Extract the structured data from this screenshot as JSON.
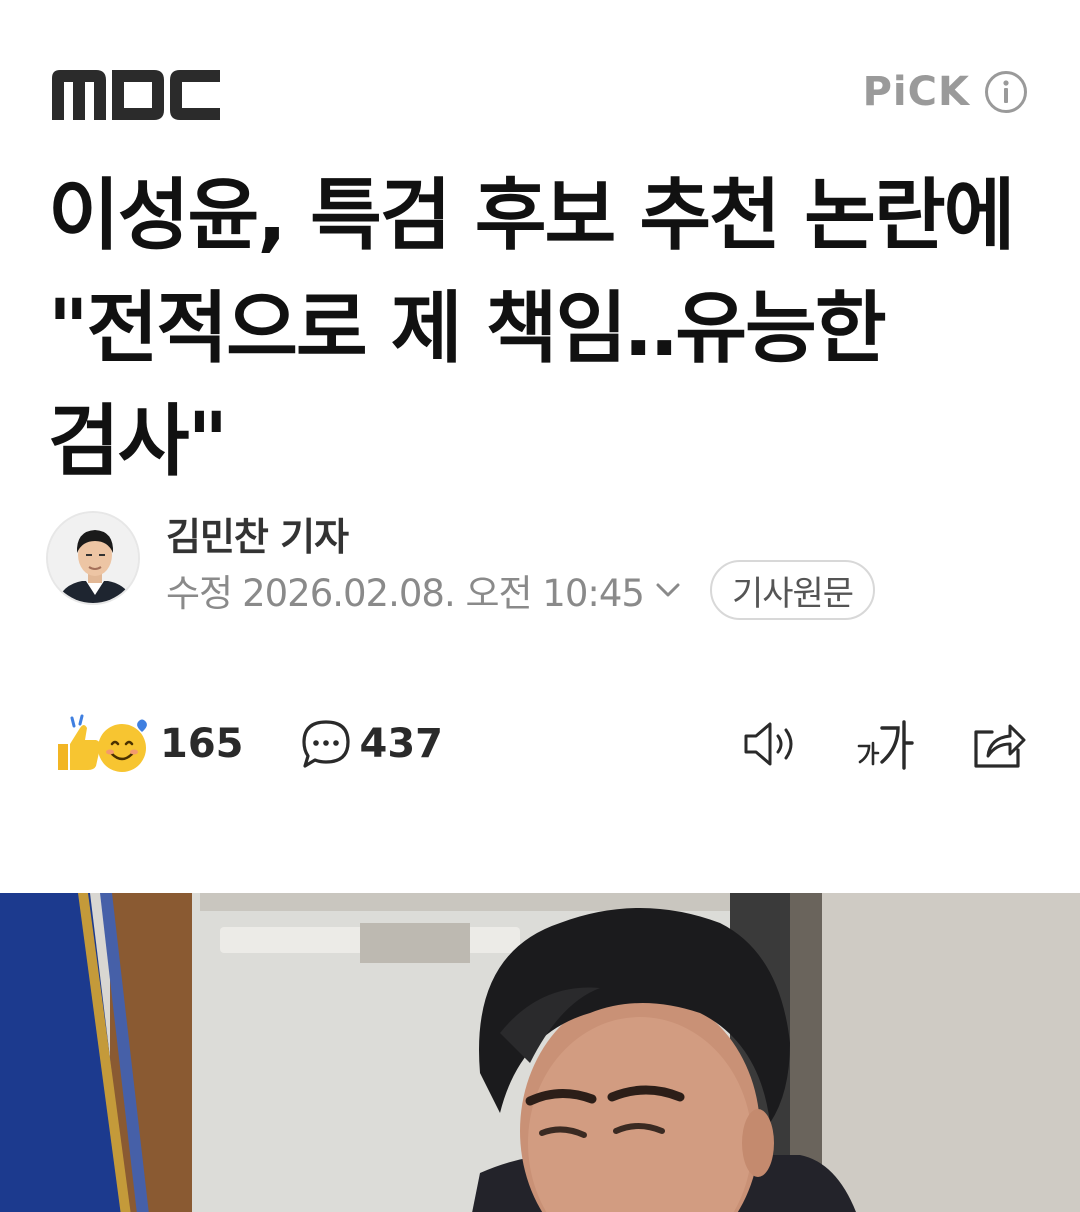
{
  "header": {
    "press_logo": "MBC",
    "pick_label": "PiCK"
  },
  "article": {
    "headline": "이성윤, 특검 후보 추천 논란에 \"전적으로 제 책임‥유능한 검사\"",
    "reporter": "김민찬 기자",
    "date_label": "수정",
    "date_value": "2026.02.08. 오전 10:45",
    "original_button": "기사원문"
  },
  "actions": {
    "reaction_count": "165",
    "comment_count": "437",
    "icons": [
      "reaction-icon",
      "comment-icon",
      "speaker-icon",
      "font-size-icon",
      "share-icon"
    ]
  },
  "colors": {
    "text": "#111111",
    "muted": "#8a8a8a",
    "pick_gray": "#9a9a9a",
    "reaction_yellow": "#f7c531",
    "reaction_blue": "#3f7fe0"
  }
}
